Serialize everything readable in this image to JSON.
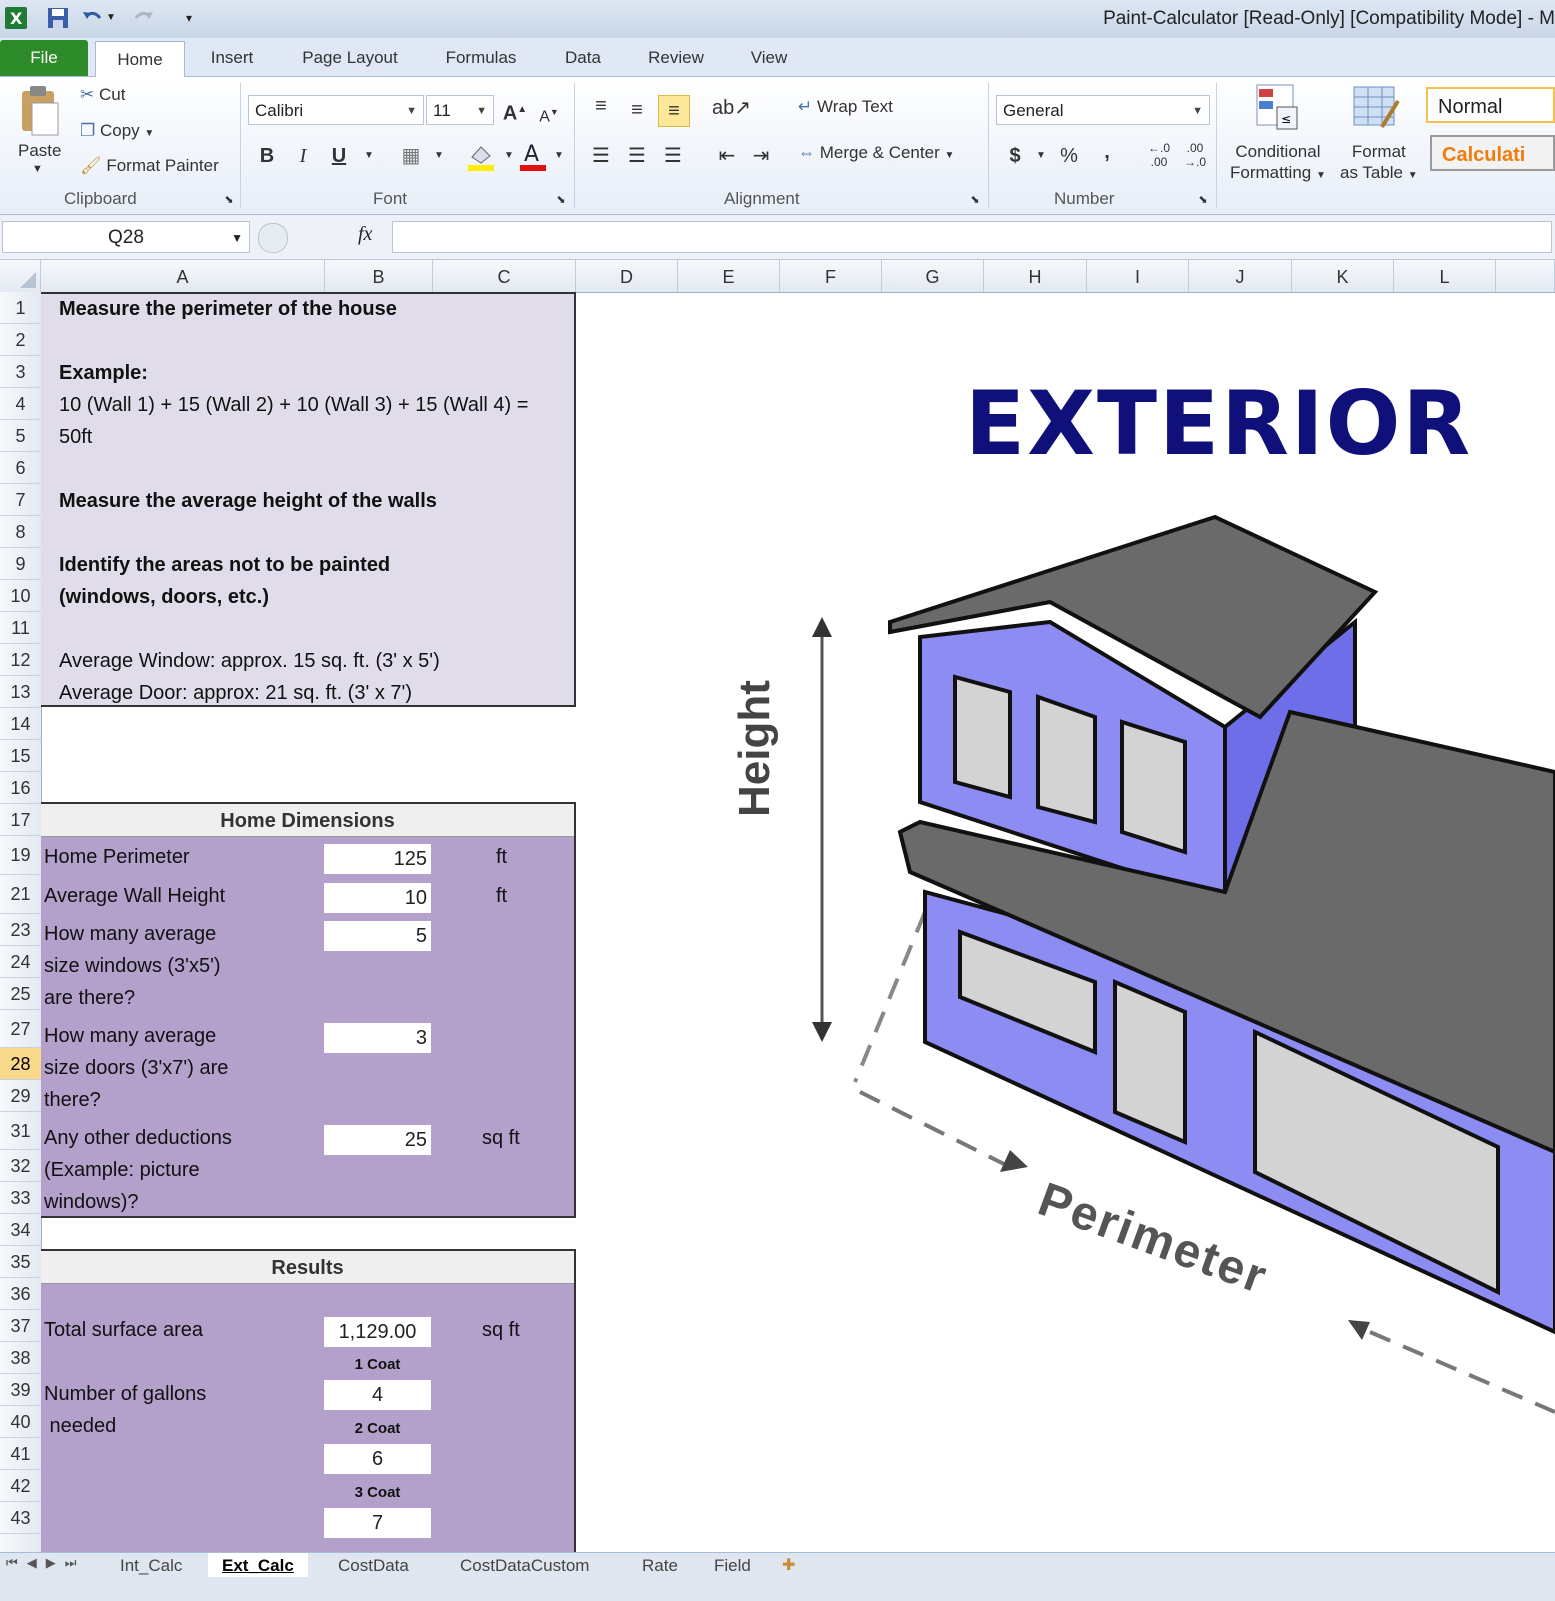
{
  "window": {
    "title": "Paint-Calculator  [Read-Only]  [Compatibility Mode]  -  M"
  },
  "ribbon_tabs": [
    "File",
    "Home",
    "Insert",
    "Page Layout",
    "Formulas",
    "Data",
    "Review",
    "View"
  ],
  "ribbon": {
    "clipboard": {
      "paste": "Paste",
      "cut": "Cut",
      "copy": "Copy",
      "format_painter": "Format Painter",
      "label": "Clipboard"
    },
    "font": {
      "name": "Calibri",
      "size": "11",
      "bold": "B",
      "italic": "I",
      "underline": "U",
      "label": "Font"
    },
    "alignment": {
      "wrap_text": "Wrap Text",
      "merge_center": "Merge & Center",
      "label": "Alignment"
    },
    "number": {
      "format": "General",
      "currency": "$",
      "percent": "%",
      "comma": ",",
      "inc_decimal": "←.0\n.00",
      "dec_decimal": ".00\n→.0",
      "label": "Number"
    },
    "styles": {
      "conditional_line1": "Conditional",
      "conditional_line2": "Formatting",
      "table_line1": "Format",
      "table_line2": "as Table",
      "normal": "Normal",
      "calculation": "Calculati"
    }
  },
  "formula_bar": {
    "name_box": "Q28",
    "fx": "fx",
    "formula": ""
  },
  "columns": [
    "A",
    "B",
    "C",
    "D",
    "E",
    "F",
    "G",
    "H",
    "I",
    "J",
    "K",
    "L"
  ],
  "rows": [
    "1",
    "2",
    "3",
    "4",
    "5",
    "6",
    "7",
    "8",
    "9",
    "10",
    "11",
    "12",
    "13",
    "14",
    "15",
    "16",
    "17",
    "19",
    "21",
    "23",
    "24",
    "25",
    "27",
    "28",
    "29",
    "31",
    "32",
    "33",
    "34",
    "35",
    "36",
    "37",
    "38",
    "39",
    "40",
    "41",
    "42",
    "43"
  ],
  "selected_row": "28",
  "instructions": {
    "line1": "Measure the perimeter of the house",
    "example_label": "Example:",
    "example_line1": "10 (Wall 1) + 15 (Wall 2) + 10 (Wall 3) + 15 (Wall 4) =",
    "example_line2": "50ft",
    "line2": "Measure the average height of the walls",
    "line3a": "Identify the areas not to be painted",
    "line3b": "(windows, doors, etc.)",
    "window_note": "Average Window: approx. 15 sq. ft. (3' x 5')",
    "door_note": "Average Door: approx: 21 sq. ft. (3' x 7')"
  },
  "home_dimensions": {
    "header": "Home Dimensions",
    "perimeter": {
      "label": "Home Perimeter",
      "value": "125",
      "unit": "ft"
    },
    "wall_height": {
      "label": "Average Wall Height",
      "value": "10",
      "unit": "ft"
    },
    "windows": {
      "label1": "How many average",
      "label2": "size windows (3'x5')",
      "label3": "are there?",
      "value": "5"
    },
    "doors": {
      "label1": "How many average",
      "label2": "size doors (3'x7') are",
      "label3": "there?",
      "value": "3"
    },
    "other": {
      "label1": "Any other deductions",
      "label2": "(Example: picture",
      "label3": "windows)?",
      "value": "25",
      "unit": "sq ft"
    }
  },
  "results": {
    "header": "Results",
    "surface": {
      "label": "Total surface area",
      "value": "1,129.00",
      "unit": "sq ft"
    },
    "gallons_label1": "Number of gallons",
    "gallons_label2": " needed",
    "coat1": {
      "label": "1 Coat",
      "value": "4"
    },
    "coat2": {
      "label": "2 Coat",
      "value": "6"
    },
    "coat3": {
      "label": "3 Coat",
      "value": "7"
    }
  },
  "illustration": {
    "title": "EXTERIOR",
    "height_label": "Height",
    "perimeter_label": "Perimeter",
    "colors": {
      "wall": "#8c8cf2",
      "roof": "#6a6a6a",
      "title": "#10107a",
      "window": "#d3d3d3",
      "panel_light": "#e1dcea",
      "panel_dark": "#b3a1cc"
    }
  },
  "sheet_tabs": [
    "Int_Calc",
    "Ext_Calc",
    "CostData",
    "CostDataCustom",
    "Rate",
    "Field"
  ],
  "active_sheet": "Ext_Calc"
}
